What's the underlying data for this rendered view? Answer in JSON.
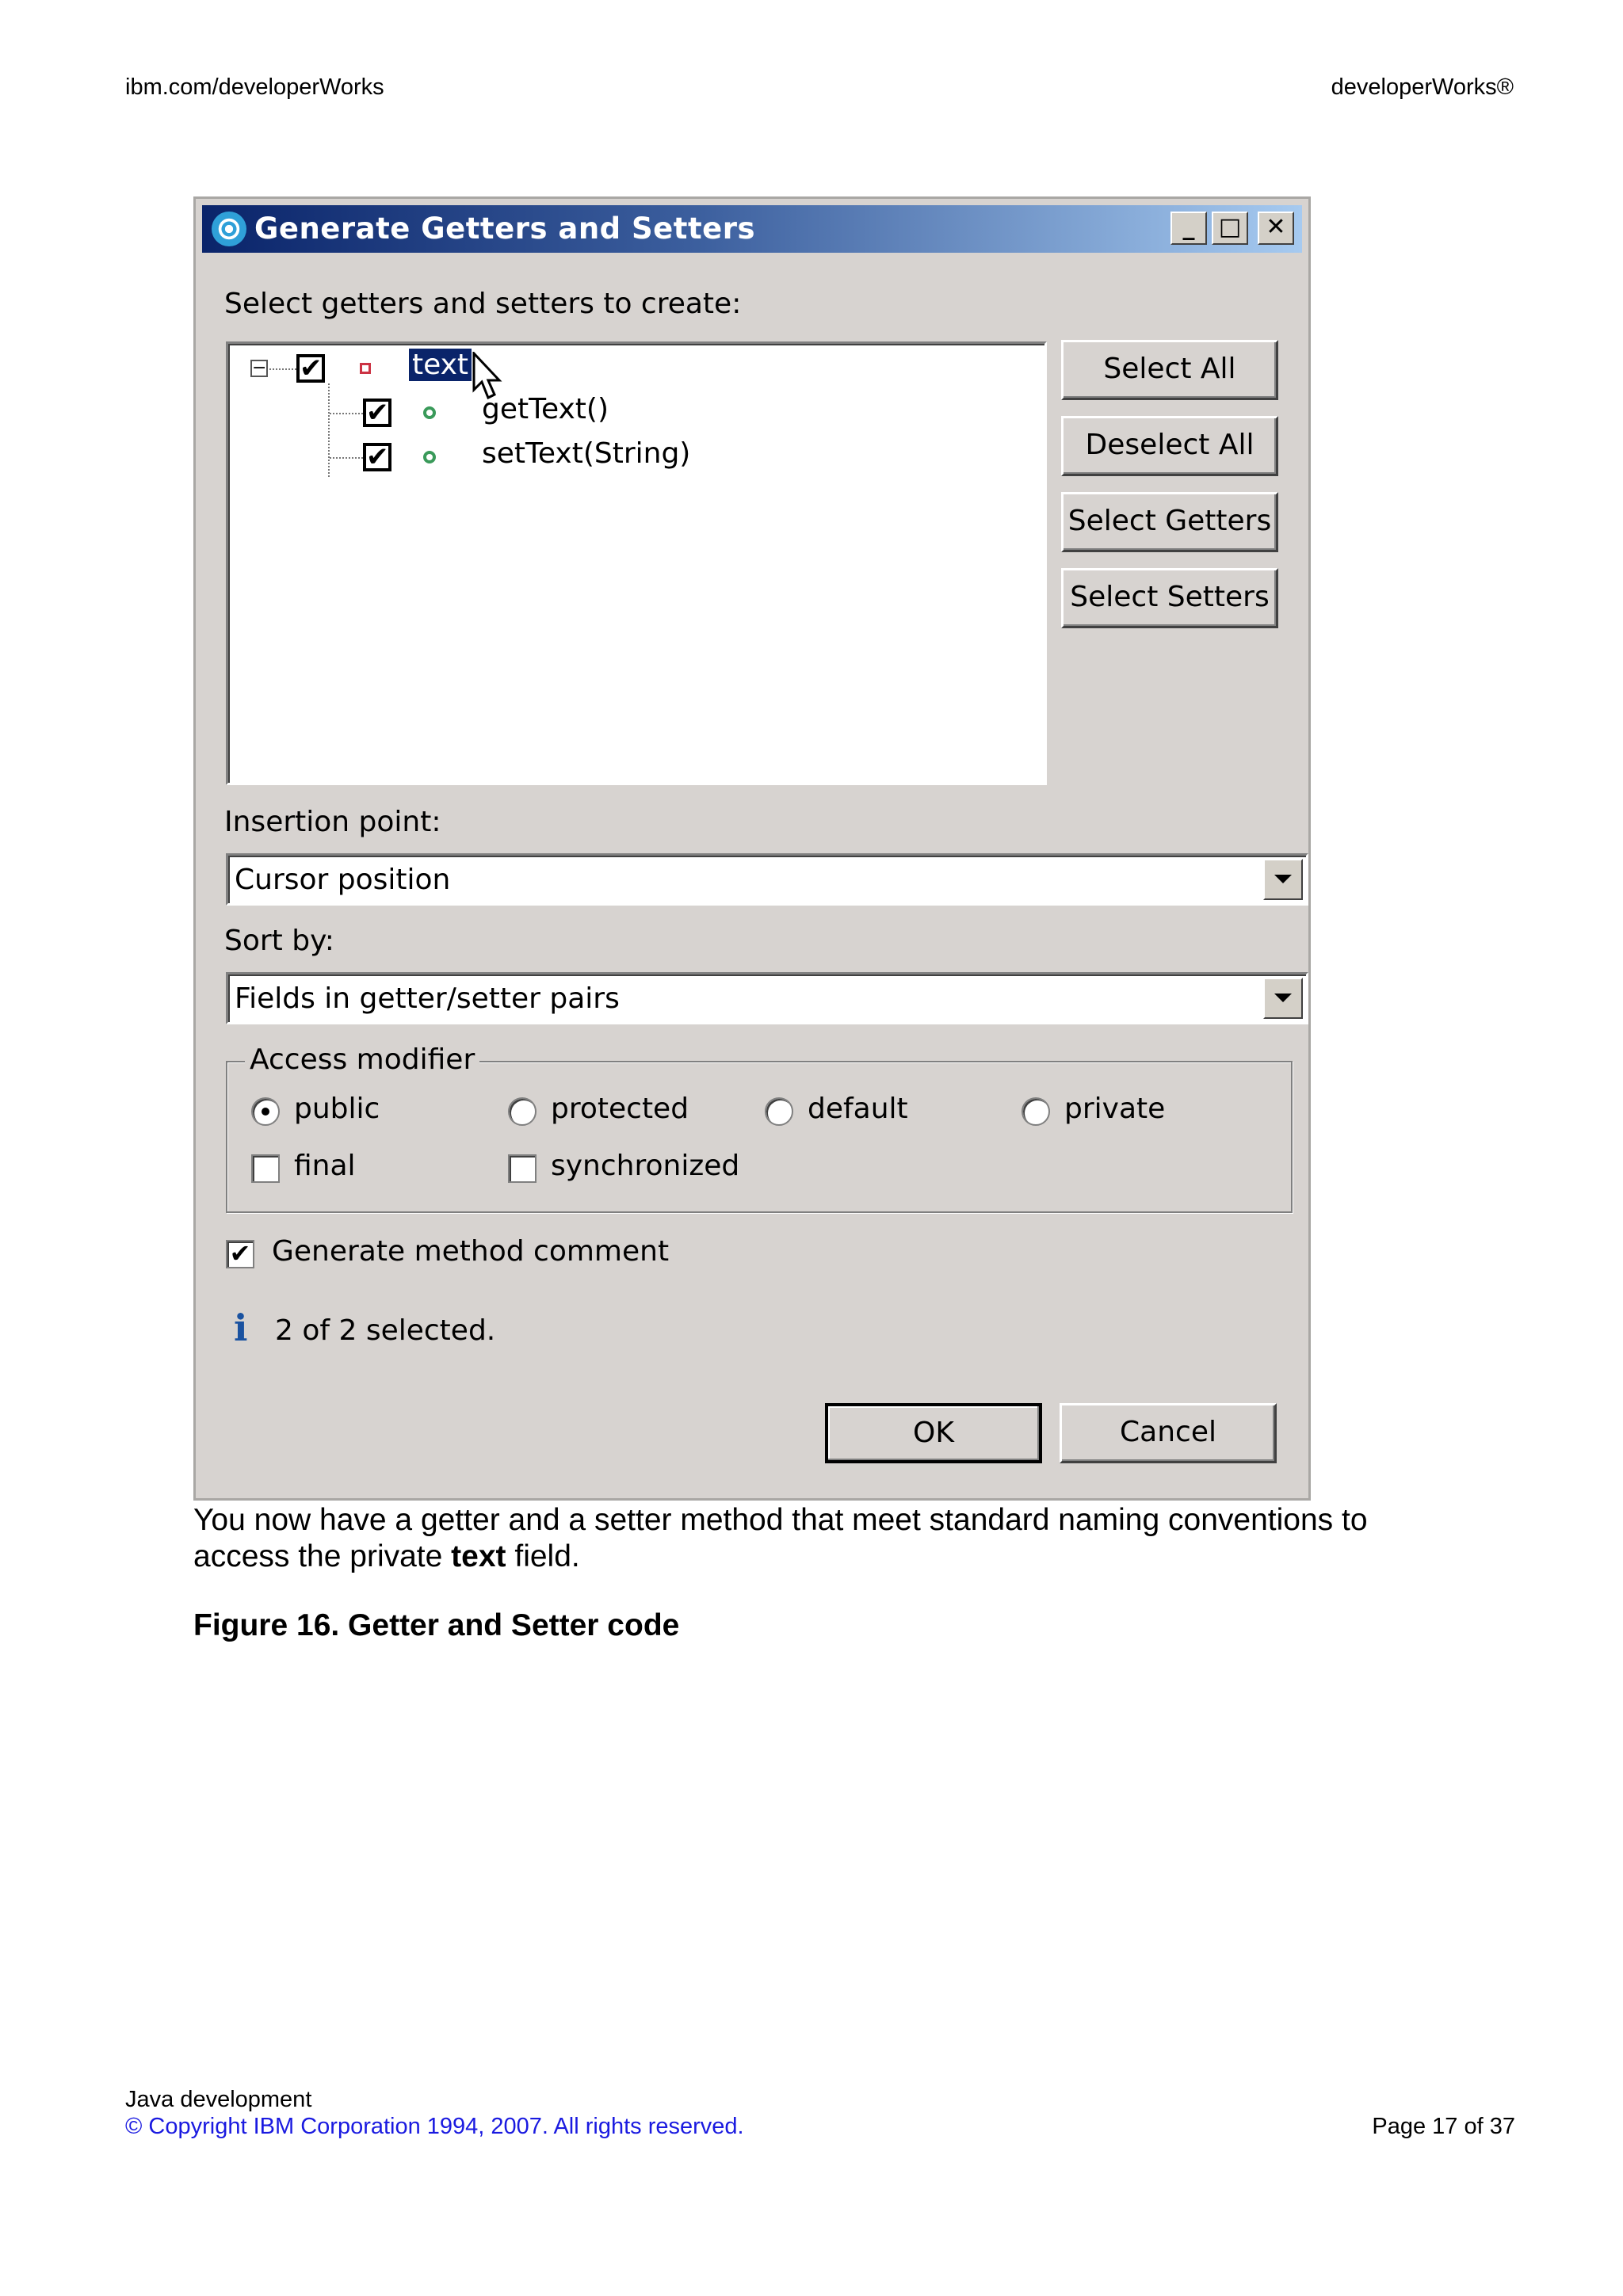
{
  "header": {
    "left": "ibm.com/developerWorks",
    "right": "developerWorks®"
  },
  "dialog": {
    "title": "Generate Getters and Setters",
    "title_buttons": {
      "minimize": "_",
      "maximize": "□",
      "close": "✕"
    },
    "prompt": "Select getters and setters to create:",
    "tree": {
      "root": {
        "label": "text",
        "checked": true,
        "expander": "−"
      },
      "children": [
        {
          "label": "getText()",
          "checked": true
        },
        {
          "label": "setText(String)",
          "checked": true
        }
      ]
    },
    "side_buttons": {
      "select_all": "Select All",
      "deselect_all": "Deselect All",
      "select_getters": "Select Getters",
      "select_setters": "Select Setters"
    },
    "insertion_point": {
      "label": "Insertion point:",
      "value": "Cursor position"
    },
    "sort_by": {
      "label": "Sort by:",
      "value": "Fields in getter/setter pairs"
    },
    "access_modifier": {
      "legend": "Access modifier",
      "radios": [
        "public",
        "protected",
        "default",
        "private"
      ],
      "selected": "public",
      "checkboxes": [
        {
          "label": "final",
          "checked": false
        },
        {
          "label": "synchronized",
          "checked": false
        }
      ]
    },
    "generate_comment": {
      "label": "Generate method comment",
      "checked": true
    },
    "status": "2 of 2 selected.",
    "ok_label": "OK",
    "cancel_label": "Cancel",
    "check_glyph": "✔",
    "info_glyph": "i"
  },
  "body": {
    "paragraph_before": "You now have a getter and a setter method that meet standard naming conventions to access the private ",
    "paragraph_bold": "text",
    "paragraph_after": " field.",
    "figure_title": "Figure 16. Getter and Setter code"
  },
  "footer": {
    "title": "Java development",
    "copyright": "© Copyright IBM Corporation 1994, 2007. All rights reserved.",
    "page": "Page 17 of 37"
  }
}
